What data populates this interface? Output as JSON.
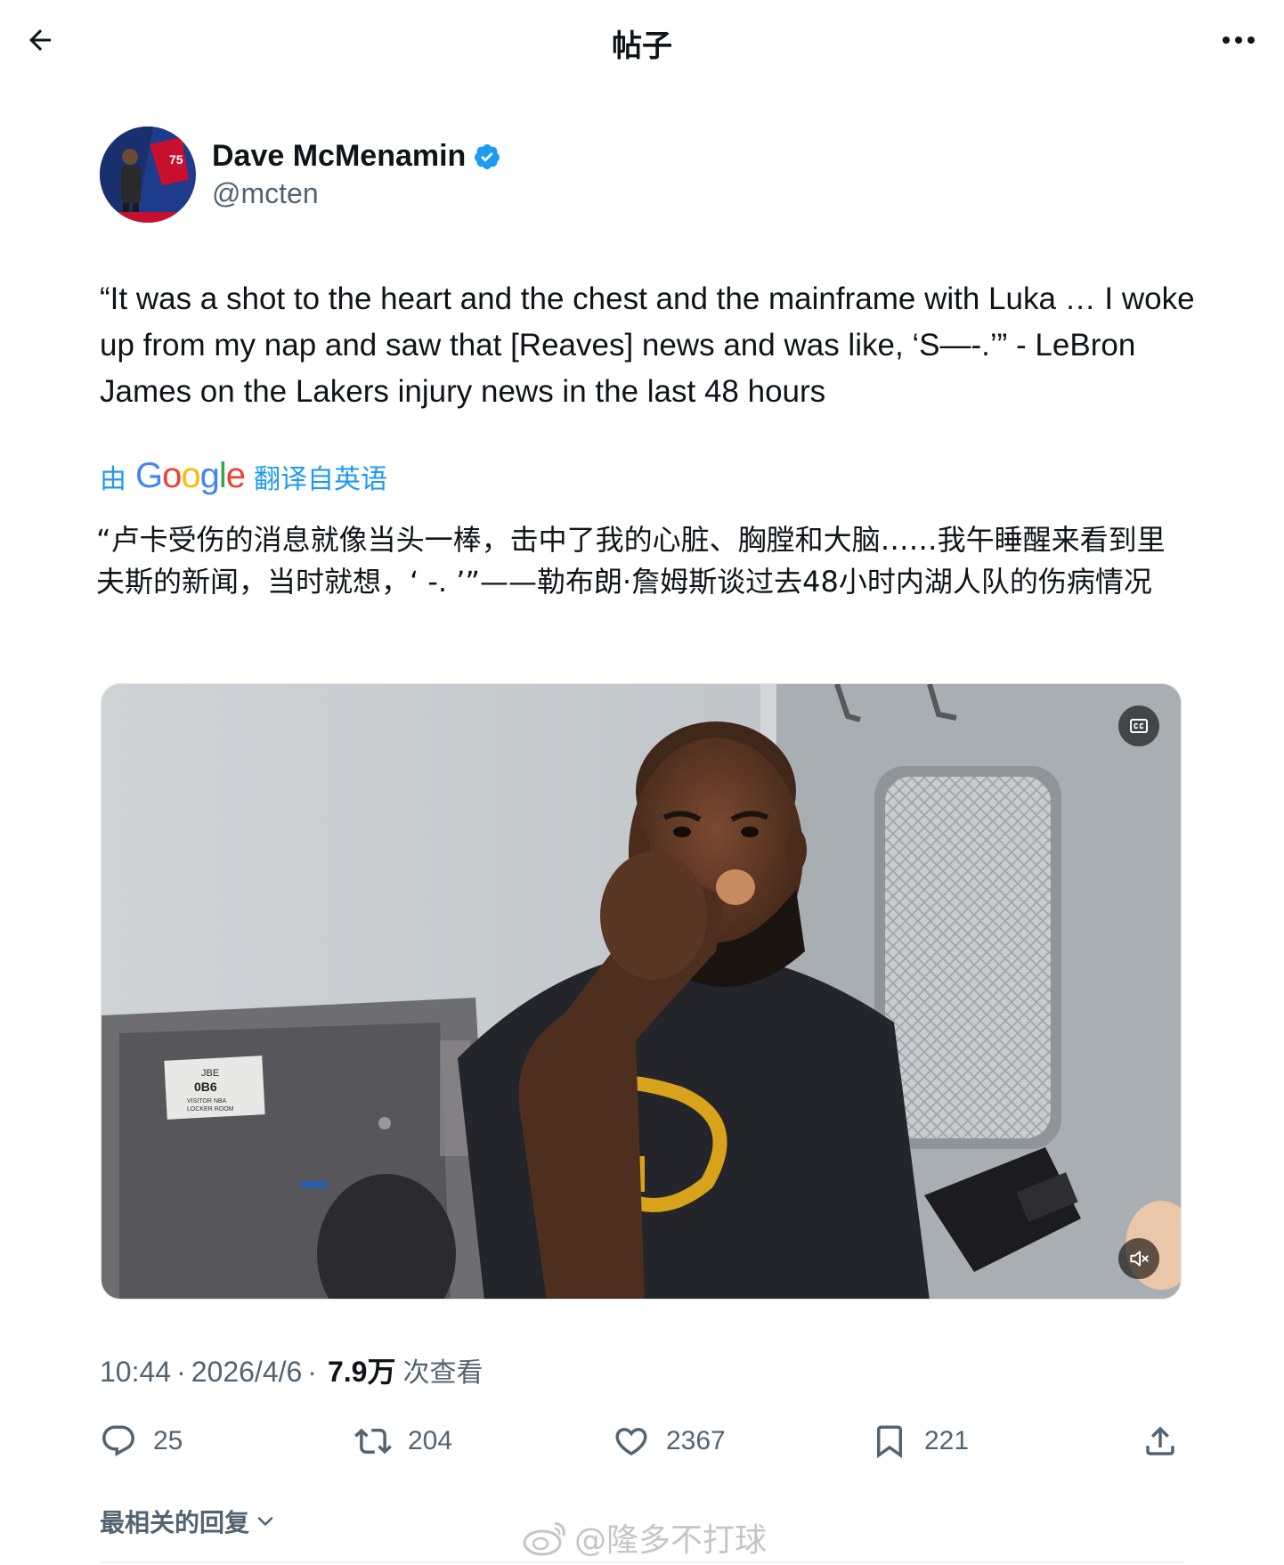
{
  "header": {
    "title": "帖子",
    "back_icon": "arrow-left-icon",
    "more_icon": "more-horizontal-icon"
  },
  "author": {
    "display_name": "Dave McMenamin",
    "handle": "@mcten",
    "verified": true,
    "verified_color": "#1d9bf0"
  },
  "tweet": {
    "text": "“It was a shot to the heart and the chest and the mainframe with Luka … I woke up from my nap and saw that [Reaves] news and was like, ‘S—-.’” - LeBron James on the Lakers injury news in the last 48 hours",
    "translation_prefix": "由",
    "translation_google": "Google",
    "translation_suffix": "翻译自英语",
    "translated_text": "“卢卡受伤的消息就像当头一棒，击中了我的心脏、胸膛和大脑……我午睡醒来看到里夫斯的新闻，当时就想，‘ -. ’”——勒布朗·詹姆斯谈过去48小时内湖人队的伤病情况"
  },
  "media": {
    "type": "video",
    "cc_icon": "closed-captions-icon",
    "mute_icon": "volume-muted-icon",
    "door_sign": {
      "line1": "JBE",
      "line2": "0B6",
      "line3": "VISITOR NBA",
      "line4": "LOCKER ROOM"
    }
  },
  "meta": {
    "time": "10:44",
    "separator": "·",
    "date": "2026/4/6",
    "views_count": "7.9万",
    "views_label": "次查看"
  },
  "actions": {
    "replies": "25",
    "reposts": "204",
    "likes": "2367",
    "bookmarks": "221"
  },
  "replies_sort": {
    "label": "最相关的回复"
  },
  "watermark": {
    "text": "@隆多不打球"
  },
  "colors": {
    "accent": "#1d9bf0",
    "text_primary": "#0f1419",
    "text_secondary": "#536471"
  }
}
